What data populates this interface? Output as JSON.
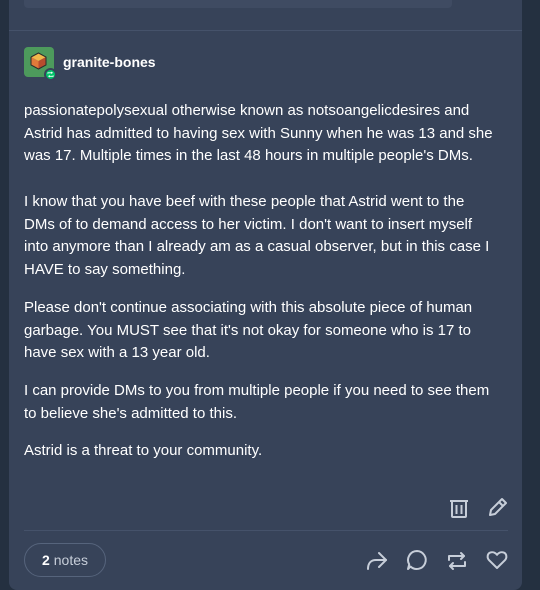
{
  "post": {
    "username": "granite-bones",
    "paragraphs": [
      {
        "lines": [
          "passionatepolysexual otherwise known as notsoangelicdesires and",
          "Astrid has admitted to having sex with Sunny when he was 13 and she",
          "was 17. Multiple times in the last 48 hours in multiple people's DMs."
        ]
      },
      {
        "lines": [
          "I know that you have beef with these people that Astrid went to the",
          "DMs of to demand access to her victim. I don't want to insert myself",
          "into anymore than I already am as a casual observer, but in this case I",
          "HAVE to say something."
        ]
      },
      {
        "lines": [
          "Please don't continue associating with this absolute piece of human",
          "garbage. You MUST see that it's not okay for someone who is 17 to",
          "have sex with a 13 year old."
        ]
      },
      {
        "lines": [
          "I can provide DMs to you from multiple people if you need to see them",
          "to believe she's admitted to this."
        ]
      },
      {
        "lines": [
          "Astrid is a threat to your community."
        ]
      }
    ]
  },
  "footer": {
    "notes_count": "2",
    "notes_label": "notes"
  },
  "icons": {
    "avatar": "cube-avatar-icon",
    "reblog_badge": "reblog-badge-icon",
    "delete": "trash-icon",
    "edit": "pencil-icon",
    "share": "share-icon",
    "reply": "reply-icon",
    "reblog": "reblog-icon",
    "like": "heart-icon"
  },
  "colors": {
    "background": "#243040",
    "card": "#374359",
    "text": "#ffffff",
    "icon": "#c7ced9",
    "badge": "#00c46a"
  }
}
